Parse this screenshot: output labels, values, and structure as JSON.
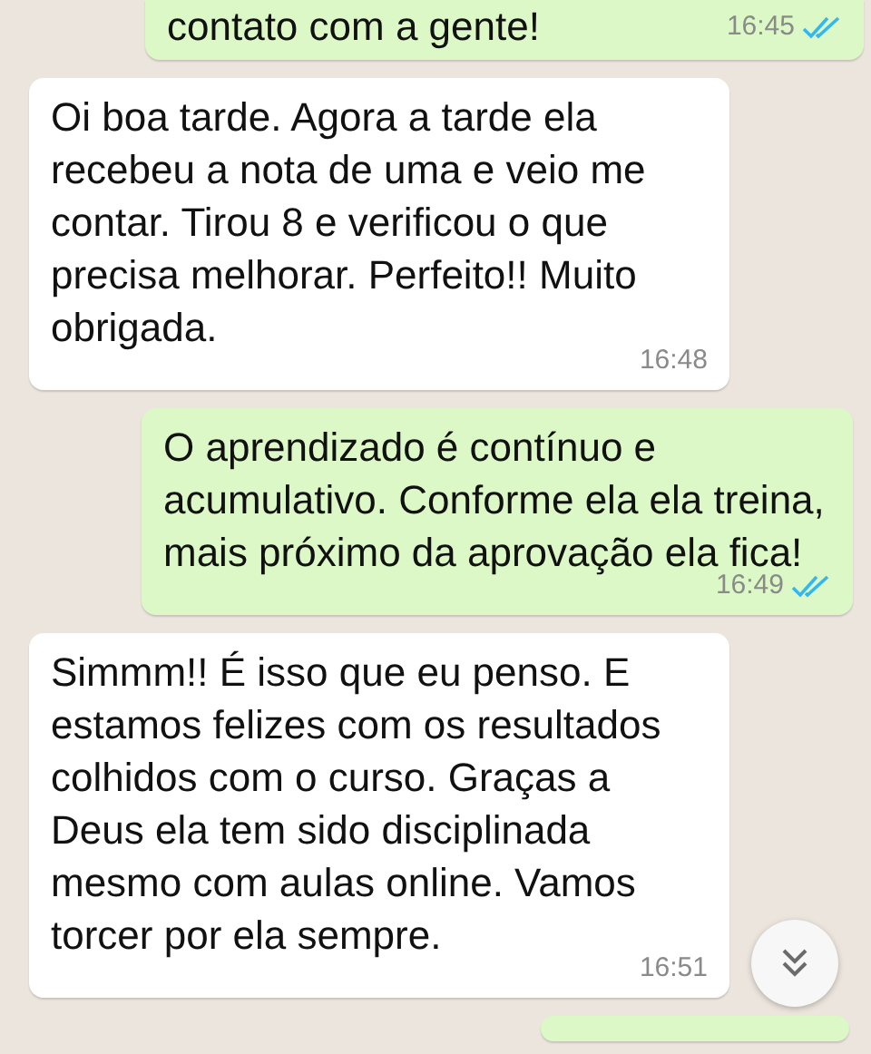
{
  "messages": [
    {
      "outgoing": true,
      "text": "contato com a gente!",
      "time": "16:45",
      "read": true
    },
    {
      "outgoing": false,
      "text": "Oi boa tarde. Agora a tarde ela recebeu a nota de uma e veio me contar. Tirou 8 e verificou o que precisa melhorar. Perfeito!! Muito obrigada.",
      "time": "16:48"
    },
    {
      "outgoing": true,
      "text": "O aprendizado é contínuo e acumulativo. Conforme ela ela treina, mais próximo da aprovação ela fica!",
      "time": "16:49",
      "read": true
    },
    {
      "outgoing": false,
      "text": "Simmm!! É isso que eu penso. E estamos felizes com os resultados colhidos com o curso. Graças a Deus ela tem sido disciplinada mesmo com aulas online. Vamos torcer por ela sempre.",
      "time": "16:51"
    },
    {
      "outgoing": true
    }
  ]
}
